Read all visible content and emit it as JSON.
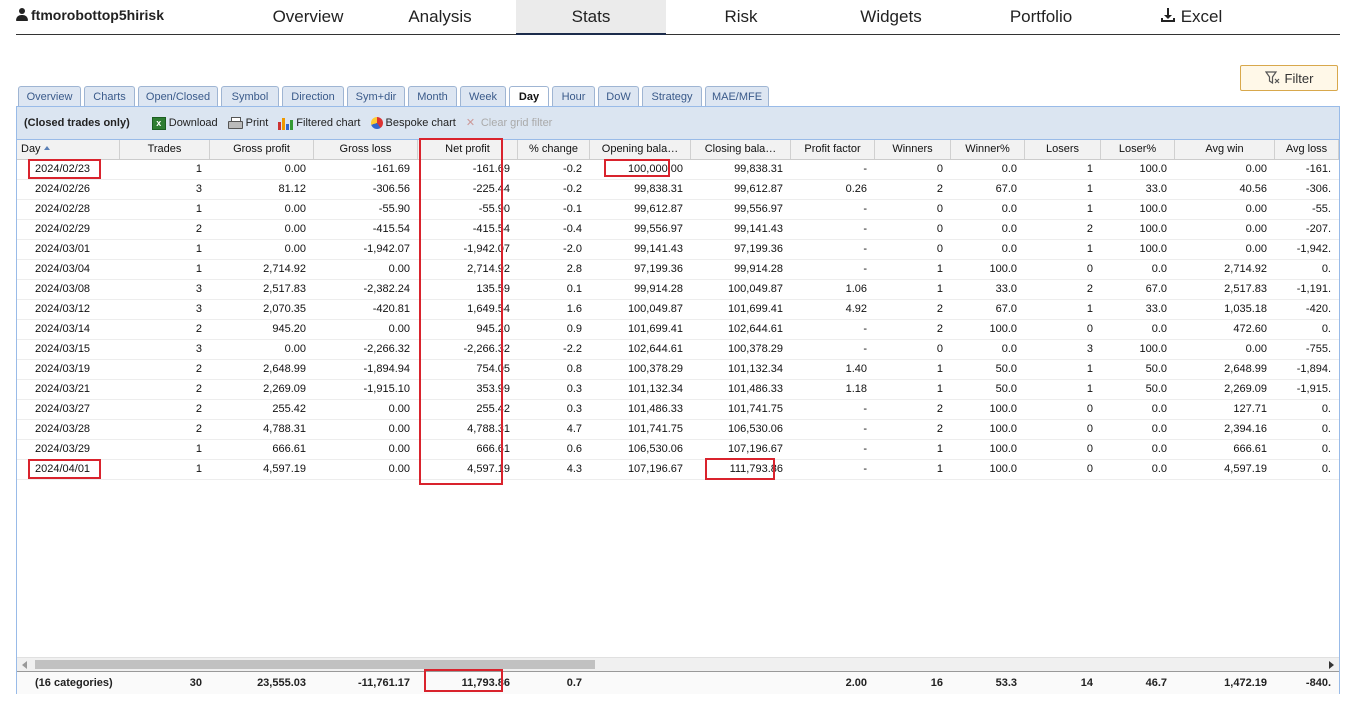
{
  "user": {
    "name": "ftmorobottop5hirisk",
    "icon": "user-icon"
  },
  "nav": {
    "tabs": [
      "Overview",
      "Analysis",
      "Stats",
      "Risk",
      "Widgets",
      "Portfolio",
      "Excel"
    ],
    "active": "Stats",
    "excel_icon": "download-icon"
  },
  "filter": {
    "label": "Filter",
    "icon": "filter-icon"
  },
  "subtabs": {
    "items": [
      "Overview",
      "Charts",
      "Open/Closed",
      "Symbol",
      "Direction",
      "Sym+dir",
      "Month",
      "Week",
      "Day",
      "Hour",
      "DoW",
      "Strategy",
      "MAE/MFE"
    ],
    "active": "Day"
  },
  "toolbar": {
    "title": "(Closed trades only)",
    "download": "Download",
    "print": "Print",
    "filtered_chart": "Filtered chart",
    "bespoke_chart": "Bespoke chart",
    "clear_filter": "Clear grid filter"
  },
  "grid": {
    "columns": [
      "Day",
      "Trades",
      "Gross profit",
      "Gross loss",
      "Net profit",
      "% change",
      "Opening bala…",
      "Closing bala…",
      "Profit factor",
      "Winners",
      "Winner%",
      "Losers",
      "Loser%",
      "Avg win",
      "Avg loss"
    ],
    "sort_column": "Day",
    "sort_direction": "ascending",
    "rows": [
      [
        "2024/02/23",
        "1",
        "0.00",
        "-161.69",
        "-161.69",
        "-0.2",
        "100,000.00",
        "99,838.31",
        "-",
        "0",
        "0.0",
        "1",
        "100.0",
        "0.00",
        "-161."
      ],
      [
        "2024/02/26",
        "3",
        "81.12",
        "-306.56",
        "-225.44",
        "-0.2",
        "99,838.31",
        "99,612.87",
        "0.26",
        "2",
        "67.0",
        "1",
        "33.0",
        "40.56",
        "-306."
      ],
      [
        "2024/02/28",
        "1",
        "0.00",
        "-55.90",
        "-55.90",
        "-0.1",
        "99,612.87",
        "99,556.97",
        "-",
        "0",
        "0.0",
        "1",
        "100.0",
        "0.00",
        "-55."
      ],
      [
        "2024/02/29",
        "2",
        "0.00",
        "-415.54",
        "-415.54",
        "-0.4",
        "99,556.97",
        "99,141.43",
        "-",
        "0",
        "0.0",
        "2",
        "100.0",
        "0.00",
        "-207."
      ],
      [
        "2024/03/01",
        "1",
        "0.00",
        "-1,942.07",
        "-1,942.07",
        "-2.0",
        "99,141.43",
        "97,199.36",
        "-",
        "0",
        "0.0",
        "1",
        "100.0",
        "0.00",
        "-1,942."
      ],
      [
        "2024/03/04",
        "1",
        "2,714.92",
        "0.00",
        "2,714.92",
        "2.8",
        "97,199.36",
        "99,914.28",
        "-",
        "1",
        "100.0",
        "0",
        "0.0",
        "2,714.92",
        "0."
      ],
      [
        "2024/03/08",
        "3",
        "2,517.83",
        "-2,382.24",
        "135.59",
        "0.1",
        "99,914.28",
        "100,049.87",
        "1.06",
        "1",
        "33.0",
        "2",
        "67.0",
        "2,517.83",
        "-1,191."
      ],
      [
        "2024/03/12",
        "3",
        "2,070.35",
        "-420.81",
        "1,649.54",
        "1.6",
        "100,049.87",
        "101,699.41",
        "4.92",
        "2",
        "67.0",
        "1",
        "33.0",
        "1,035.18",
        "-420."
      ],
      [
        "2024/03/14",
        "2",
        "945.20",
        "0.00",
        "945.20",
        "0.9",
        "101,699.41",
        "102,644.61",
        "-",
        "2",
        "100.0",
        "0",
        "0.0",
        "472.60",
        "0."
      ],
      [
        "2024/03/15",
        "3",
        "0.00",
        "-2,266.32",
        "-2,266.32",
        "-2.2",
        "102,644.61",
        "100,378.29",
        "-",
        "0",
        "0.0",
        "3",
        "100.0",
        "0.00",
        "-755."
      ],
      [
        "2024/03/19",
        "2",
        "2,648.99",
        "-1,894.94",
        "754.05",
        "0.8",
        "100,378.29",
        "101,132.34",
        "1.40",
        "1",
        "50.0",
        "1",
        "50.0",
        "2,648.99",
        "-1,894."
      ],
      [
        "2024/03/21",
        "2",
        "2,269.09",
        "-1,915.10",
        "353.99",
        "0.3",
        "101,132.34",
        "101,486.33",
        "1.18",
        "1",
        "50.0",
        "1",
        "50.0",
        "2,269.09",
        "-1,915."
      ],
      [
        "2024/03/27",
        "2",
        "255.42",
        "0.00",
        "255.42",
        "0.3",
        "101,486.33",
        "101,741.75",
        "-",
        "2",
        "100.0",
        "0",
        "0.0",
        "127.71",
        "0."
      ],
      [
        "2024/03/28",
        "2",
        "4,788.31",
        "0.00",
        "4,788.31",
        "4.7",
        "101,741.75",
        "106,530.06",
        "-",
        "2",
        "100.0",
        "0",
        "0.0",
        "2,394.16",
        "0."
      ],
      [
        "2024/03/29",
        "1",
        "666.61",
        "0.00",
        "666.61",
        "0.6",
        "106,530.06",
        "107,196.67",
        "-",
        "1",
        "100.0",
        "0",
        "0.0",
        "666.61",
        "0."
      ],
      [
        "2024/04/01",
        "1",
        "4,597.19",
        "0.00",
        "4,597.19",
        "4.3",
        "107,196.67",
        "111,793.86",
        "-",
        "1",
        "100.0",
        "0",
        "0.0",
        "4,597.19",
        "0."
      ]
    ],
    "totals": [
      "(16 categories)",
      "30",
      "23,555.03",
      "-11,761.17",
      "11,793.86",
      "0.7",
      "",
      "",
      "2.00",
      "16",
      "53.3",
      "14",
      "46.7",
      "1,472.19",
      "-840."
    ]
  },
  "colors": {
    "highlight": "#d9232d",
    "tab_bg": "#dde6f2",
    "toolbar_bg": "#dbe5f1",
    "nav_active_border": "#1c2c4c",
    "filter_border": "#d8a84c"
  }
}
